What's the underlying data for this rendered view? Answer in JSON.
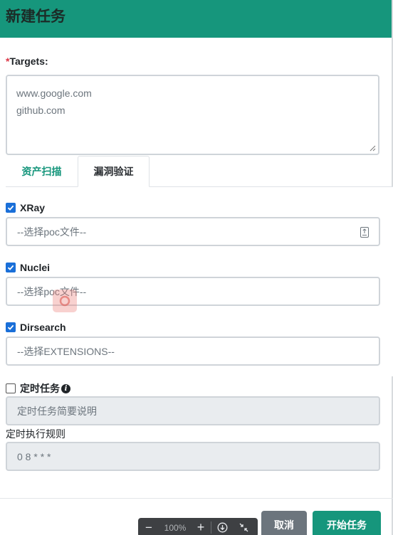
{
  "header": {
    "title": "新建任务"
  },
  "targets": {
    "required_mark": "*",
    "label": "Targets:",
    "lines": [
      "www.google.com",
      "github.com"
    ]
  },
  "tabs": [
    {
      "label": "资产扫描",
      "active": false
    },
    {
      "label": "漏洞验证",
      "active": true
    }
  ],
  "scanners": {
    "xray": {
      "label": "XRay",
      "checked": true,
      "placeholder": "--选择poc文件--"
    },
    "nuclei": {
      "label": "Nuclei",
      "checked": true,
      "placeholder": "--选择poc文件--"
    },
    "dirsearch": {
      "label": "Dirsearch",
      "checked": true,
      "placeholder": "--选择EXTENSIONS--"
    }
  },
  "schedule": {
    "label": "定时任务",
    "checked": false,
    "description_placeholder": "定时任务简要说明",
    "rule_label": "定时执行规则",
    "rule_placeholder": "0 8 * * *"
  },
  "buttons": {
    "cancel": "取消",
    "start": "开始任务"
  },
  "zoom": {
    "value": "100%",
    "minus": "−",
    "plus": "+"
  },
  "colors": {
    "accent": "#16967c",
    "checkbox": "#1a6fd8",
    "required": "#dc3545",
    "cancel": "#6c757d"
  },
  "icons": {
    "info": "info-circle-icon",
    "file": "file-upload-icon",
    "download": "download-icon",
    "collapse": "collapse-icon"
  }
}
